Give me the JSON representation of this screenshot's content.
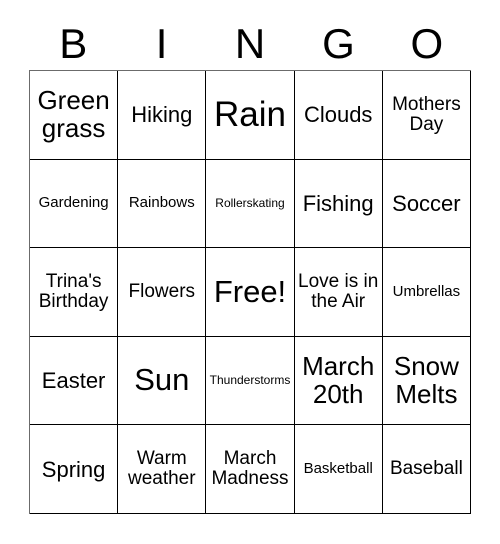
{
  "card": {
    "title_letters": [
      "B",
      "I",
      "N",
      "G",
      "O"
    ],
    "rows": [
      [
        {
          "text": "Green grass",
          "size": "xl"
        },
        {
          "text": "Hiking",
          "size": "lg"
        },
        {
          "text": "Rain",
          "size": "huge"
        },
        {
          "text": "Clouds",
          "size": "lg"
        },
        {
          "text": "Mothers Day",
          "size": "md"
        }
      ],
      [
        {
          "text": "Gardening",
          "size": "sm"
        },
        {
          "text": "Rainbows",
          "size": "sm"
        },
        {
          "text": "Rollerskating",
          "size": "xs"
        },
        {
          "text": "Fishing",
          "size": "lg"
        },
        {
          "text": "Soccer",
          "size": "lg"
        }
      ],
      [
        {
          "text": "Trina's Birthday",
          "size": "md"
        },
        {
          "text": "Flowers",
          "size": "md"
        },
        {
          "text": "Free!",
          "size": "xxl"
        },
        {
          "text": "Love is in the Air",
          "size": "md"
        },
        {
          "text": "Umbrellas",
          "size": "sm"
        }
      ],
      [
        {
          "text": "Easter",
          "size": "lg"
        },
        {
          "text": "Sun",
          "size": "xxl"
        },
        {
          "text": "Thunderstorms",
          "size": "xs"
        },
        {
          "text": "March 20th",
          "size": "xl"
        },
        {
          "text": "Snow Melts",
          "size": "xl"
        }
      ],
      [
        {
          "text": "Spring",
          "size": "lg"
        },
        {
          "text": "Warm weather",
          "size": "md"
        },
        {
          "text": "March Madness",
          "size": "md"
        },
        {
          "text": "Basketball",
          "size": "sm"
        },
        {
          "text": "Baseball",
          "size": "md"
        }
      ]
    ],
    "free_space": {
      "row": 2,
      "col": 2,
      "label": "Free!"
    },
    "colors": {
      "background": "#ffffff",
      "text": "#000000",
      "grid_line": "#000000",
      "grid_outer_line": "#6b6b6b"
    }
  }
}
